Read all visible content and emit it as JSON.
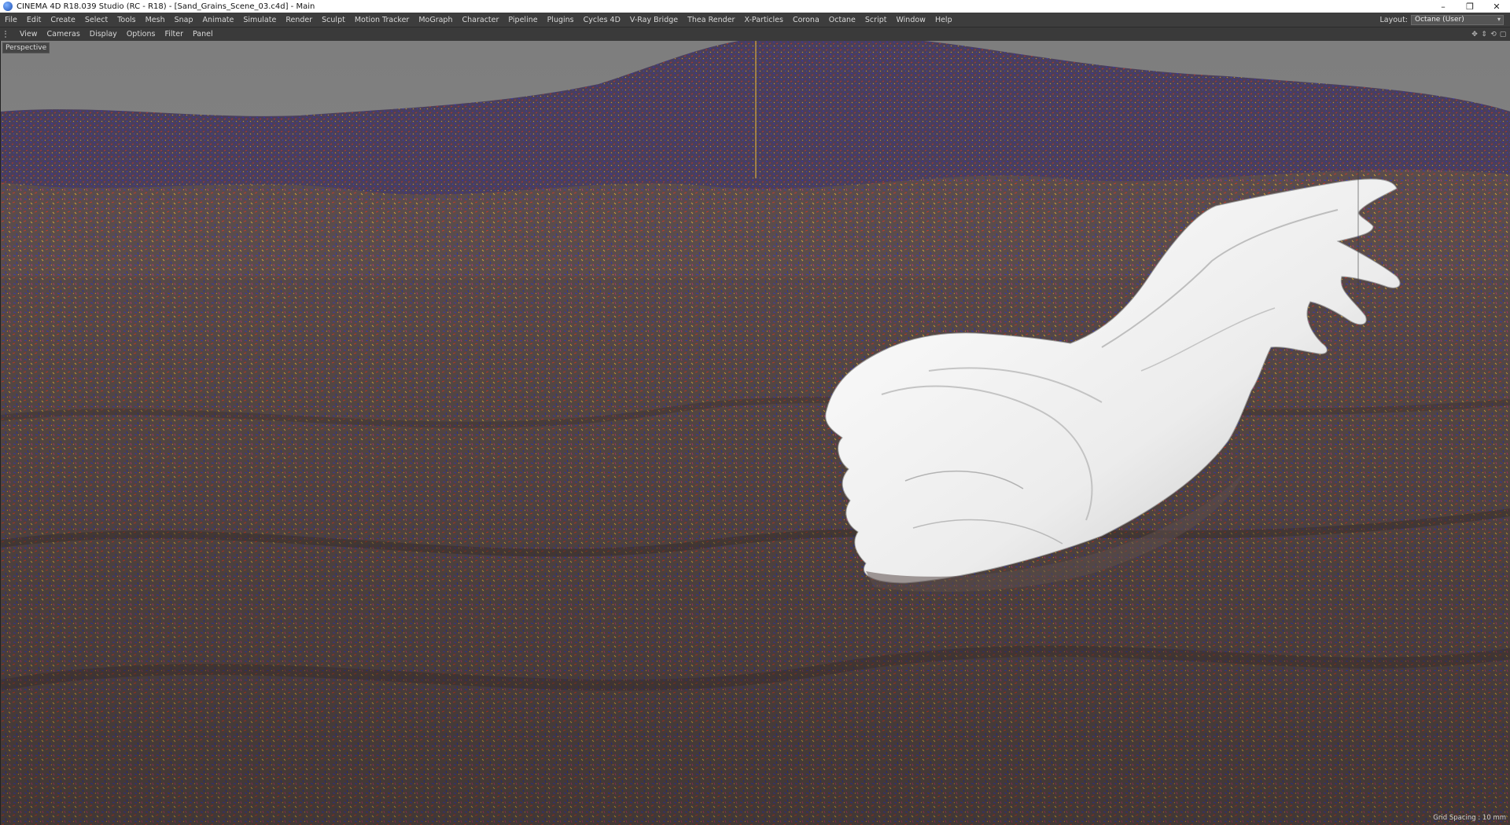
{
  "window": {
    "title": "CINEMA 4D R18.039 Studio (RC - R18) - [Sand_Grains_Scene_03.c4d] - Main",
    "controls": [
      "–",
      "❐",
      "✕"
    ]
  },
  "menubar": {
    "items": [
      "File",
      "Edit",
      "Create",
      "Select",
      "Tools",
      "Mesh",
      "Snap",
      "Animate",
      "Simulate",
      "Render",
      "Sculpt",
      "Motion Tracker",
      "MoGraph",
      "Character",
      "Pipeline",
      "Plugins",
      "Cycles 4D",
      "V-Ray Bridge",
      "Thea Render",
      "X-Particles",
      "Corona",
      "Octane",
      "Script",
      "Window",
      "Help"
    ],
    "layout_label": "Layout:",
    "layout_value": "Octane (User)"
  },
  "viewport_menu": {
    "items": [
      "View",
      "Cameras",
      "Display",
      "Options",
      "Filter",
      "Panel"
    ],
    "nav_icons": [
      "move-icon",
      "pan-icon",
      "rotate-icon",
      "maximize-icon"
    ]
  },
  "viewport": {
    "label": "Perspective",
    "grid_spacing": "Grid Spacing : 10 mm",
    "colors": {
      "sky": "#8a8a8a",
      "sand": "#5b4d48",
      "shell": "#f2f2f2",
      "axis": "#e8c13a"
    }
  }
}
